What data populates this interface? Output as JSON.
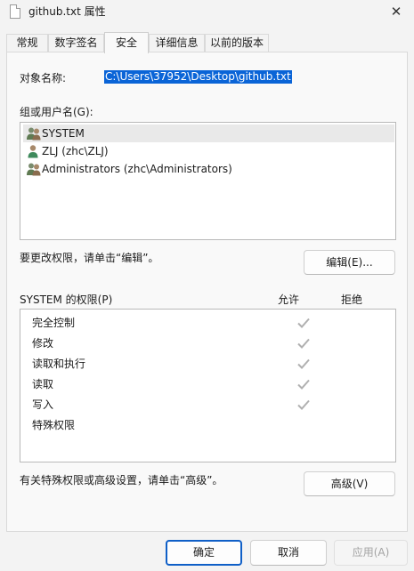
{
  "window": {
    "title": "github.txt 属性",
    "close_glyph": "✕"
  },
  "tabs": [
    {
      "label": "常规",
      "active": false
    },
    {
      "label": "数字签名",
      "active": false
    },
    {
      "label": "安全",
      "active": true
    },
    {
      "label": "详细信息",
      "active": false
    },
    {
      "label": "以前的版本",
      "active": false
    }
  ],
  "object": {
    "label": "对象名称:",
    "value": "C:\\Users\\37952\\Desktop\\github.txt"
  },
  "groups": {
    "label": "组或用户名(G):",
    "items": [
      {
        "name": "SYSTEM",
        "icon": "user-group-icon",
        "selected": true
      },
      {
        "name": "ZLJ (zhc\\ZLJ)",
        "icon": "user-icon",
        "selected": false
      },
      {
        "name": "Administrators (zhc\\Administrators)",
        "icon": "user-group-icon",
        "selected": false
      }
    ]
  },
  "change_hint": "要更改权限，请单击“编辑”。",
  "edit_button": "编辑(E)...",
  "permissions": {
    "label": "SYSTEM 的权限(P)",
    "allow_header": "允许",
    "deny_header": "拒绝",
    "rows": [
      {
        "name": "完全控制",
        "allow": true,
        "deny": false
      },
      {
        "name": "修改",
        "allow": true,
        "deny": false
      },
      {
        "name": "读取和执行",
        "allow": true,
        "deny": false
      },
      {
        "name": "读取",
        "allow": true,
        "deny": false
      },
      {
        "name": "写入",
        "allow": true,
        "deny": false
      },
      {
        "name": "特殊权限",
        "allow": false,
        "deny": false
      }
    ]
  },
  "advanced_hint": "有关特殊权限或高级设置，请单击“高级”。",
  "advanced_button": "高级(V)",
  "footer": {
    "ok": "确定",
    "cancel": "取消",
    "apply": "应用(A)"
  },
  "colors": {
    "selection": "#0a64d7",
    "check": "#b0b0b0",
    "primary_border": "#0f5fc7"
  }
}
